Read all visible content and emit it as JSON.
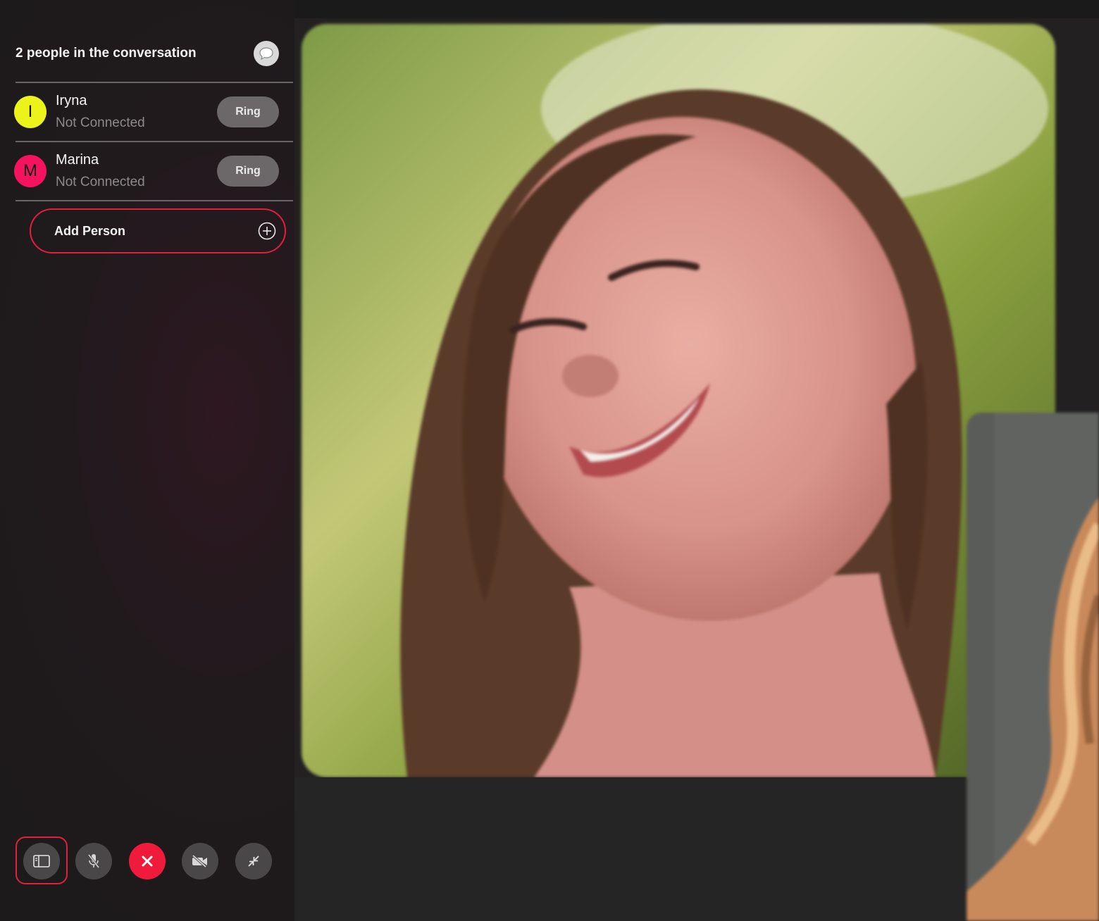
{
  "sidebar": {
    "people_count": "2 people in the conversation",
    "chat_icon": "speech-bubble-icon",
    "participants": [
      {
        "initial": "I",
        "name": "Iryna",
        "status": "Not Connected",
        "avatar_color": "#ecf31a",
        "ring_label": "Ring"
      },
      {
        "initial": "M",
        "name": "Marina",
        "status": "Not Connected",
        "avatar_color": "#f5125e",
        "ring_label": "Ring"
      }
    ],
    "add_person_label": "Add Person",
    "add_person_icon": "plus-circle-icon"
  },
  "controls": [
    {
      "name": "sidebar-toggle-button",
      "icon": "sidebar-icon"
    },
    {
      "name": "mute-button",
      "icon": "microphone-muted-icon"
    },
    {
      "name": "end-call-button",
      "icon": "close-icon",
      "color": "#ef1a3c"
    },
    {
      "name": "video-toggle-button",
      "icon": "video-off-icon"
    },
    {
      "name": "minimize-button",
      "icon": "collapse-arrows-icon"
    }
  ],
  "colors": {
    "accent": "#e0203c",
    "end_call": "#ef1a3c"
  }
}
